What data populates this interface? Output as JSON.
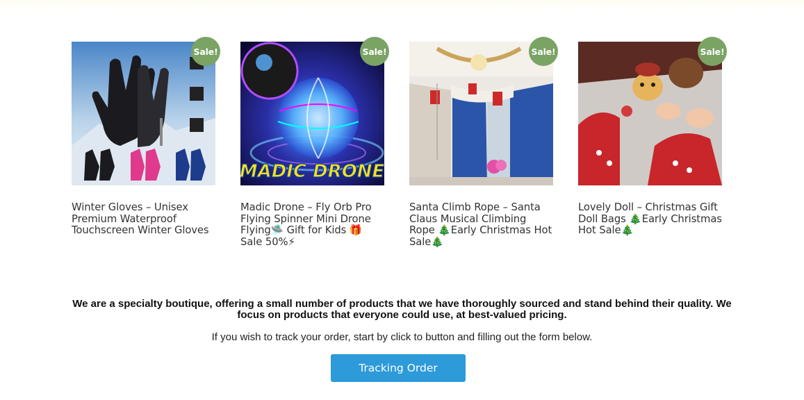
{
  "products": [
    {
      "title": "Winter Gloves – Unisex Premium Waterproof Touchscreen Winter Gloves",
      "badge": "Sale!",
      "image": "winter-gloves-photo"
    },
    {
      "title": "Madic Drone – Fly Orb Pro Flying Spinner Mini Drone Flying🛸 Gift for Kids 🎁 Sale 50%⚡",
      "badge": "Sale!",
      "image": "madic-drone-photo",
      "image_text": "MADIC DRONE"
    },
    {
      "title": "Santa Climb Rope – Santa Claus Musical Climbing Rope 🎄Early Christmas Hot Sale🎄",
      "badge": "Sale!",
      "image": "santa-climb-rope-photo"
    },
    {
      "title": "Lovely Doll – Christmas Gift Doll Bags 🎄Early Christmas Hot Sale🎄",
      "badge": "Sale!",
      "image": "lovely-doll-photo"
    }
  ],
  "about_text": "We are a specialty boutique, offering a small number of products that we have thoroughly sourced and stand behind their quality. We focus on products that everyone could use, at best-valued pricing.",
  "track_text": "If you wish to track your order, start by click to button and filling out the form below.",
  "track_button_label": "Tracking Order",
  "colors": {
    "sale_badge": "#7aa364",
    "button": "#2d9ad9"
  }
}
